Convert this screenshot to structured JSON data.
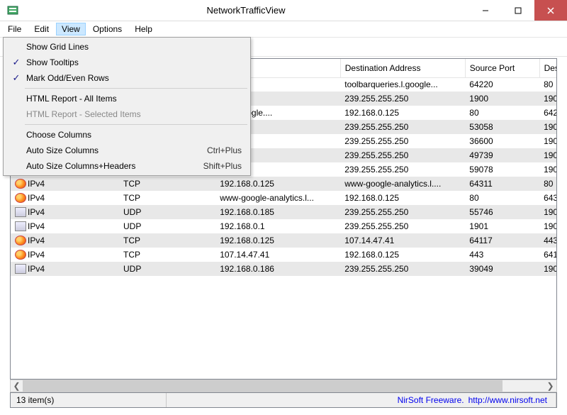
{
  "window": {
    "title": "NetworkTrafficView"
  },
  "menu": {
    "file": "File",
    "edit": "Edit",
    "view": "View",
    "options": "Options",
    "help": "Help"
  },
  "viewmenu": {
    "show_grid_lines": "Show Grid Lines",
    "show_tooltips": "Show Tooltips",
    "mark_odd_even": "Mark Odd/Even Rows",
    "html_all": "HTML Report - All Items",
    "html_sel": "HTML Report - Selected Items",
    "choose_cols": "Choose Columns",
    "auto_size_cols": "Auto Size Columns",
    "auto_size_cols_sc": "Ctrl+Plus",
    "auto_size_ch": "Auto Size Columns+Headers",
    "auto_size_ch_sc": "Shift+Plus"
  },
  "columns": {
    "ether": "",
    "ip": "",
    "proto": "",
    "src": "ess",
    "dst": "Destination Address",
    "sport": "Source Port",
    "dport": "Des"
  },
  "rows": [
    {
      "icon": "doc",
      "ether": "",
      "ip": "",
      "proto": "",
      "src": "5",
      "dst": "toolbarqueries.l.google...",
      "sport": "64220",
      "dport": "80"
    },
    {
      "icon": "doc",
      "ether": "",
      "ip": "",
      "proto": "",
      "src": "",
      "dst": "239.255.255.250",
      "sport": "1900",
      "dport": "190"
    },
    {
      "icon": "ff",
      "ether": "",
      "ip": "",
      "proto": "",
      "src": "ies.l.google....",
      "dst": "192.168.0.125",
      "sport": "80",
      "dport": "642"
    },
    {
      "icon": "doc",
      "ether": "",
      "ip": "",
      "proto": "",
      "src": "",
      "dst": "239.255.255.250",
      "sport": "53058",
      "dport": "190"
    },
    {
      "icon": "doc",
      "ether": "",
      "ip": "",
      "proto": "",
      "src": "6",
      "dst": "239.255.255.250",
      "sport": "36600",
      "dport": "190"
    },
    {
      "icon": "doc",
      "ether": "",
      "ip": "",
      "proto": "",
      "src": "5",
      "dst": "239.255.255.250",
      "sport": "49739",
      "dport": "190"
    },
    {
      "icon": "doc",
      "ether": "",
      "ip": "",
      "proto": "",
      "src": "",
      "dst": "239.255.255.250",
      "sport": "59078",
      "dport": "190"
    },
    {
      "icon": "ff",
      "ether": "IPv4",
      "ip": "",
      "proto": "TCP",
      "src": "192.168.0.125",
      "dst": "www-google-analytics.l....",
      "sport": "64311",
      "dport": "80"
    },
    {
      "icon": "ff",
      "ether": "IPv4",
      "ip": "",
      "proto": "TCP",
      "src": "www-google-analytics.l...",
      "dst": "192.168.0.125",
      "sport": "80",
      "dport": "643"
    },
    {
      "icon": "doc",
      "ether": "IPv4",
      "ip": "",
      "proto": "UDP",
      "src": "192.168.0.185",
      "dst": "239.255.255.250",
      "sport": "55746",
      "dport": "190"
    },
    {
      "icon": "doc",
      "ether": "IPv4",
      "ip": "",
      "proto": "UDP",
      "src": "192.168.0.1",
      "dst": "239.255.255.250",
      "sport": "1901",
      "dport": "190"
    },
    {
      "icon": "ff",
      "ether": "IPv4",
      "ip": "",
      "proto": "TCP",
      "src": "192.168.0.125",
      "dst": "107.14.47.41",
      "sport": "64117",
      "dport": "443"
    },
    {
      "icon": "ff",
      "ether": "IPv4",
      "ip": "",
      "proto": "TCP",
      "src": "107.14.47.41",
      "dst": "192.168.0.125",
      "sport": "443",
      "dport": "641"
    },
    {
      "icon": "doc",
      "ether": "IPv4",
      "ip": "",
      "proto": "UDP",
      "src": "192.168.0.186",
      "dst": "239.255.255.250",
      "sport": "39049",
      "dport": "190"
    }
  ],
  "status": {
    "count": "13 item(s)",
    "brand": "NirSoft Freeware.",
    "url": "http://www.nirsoft.net"
  }
}
